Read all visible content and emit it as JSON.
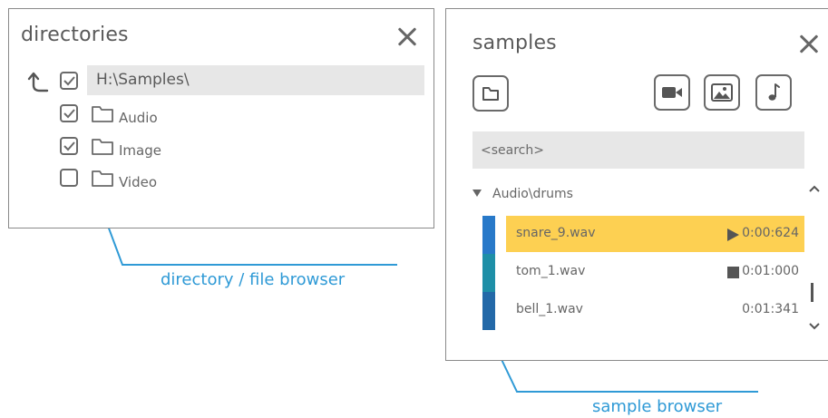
{
  "directories": {
    "title": "directories",
    "path": "H:\\Samples\\",
    "items": [
      {
        "label": "Audio",
        "checked": true
      },
      {
        "label": "Image",
        "checked": true
      },
      {
        "label": "Video",
        "checked": false
      }
    ],
    "root_checked": true
  },
  "samples": {
    "title": "samples",
    "search_placeholder": "<search>",
    "group_label": "Audio\\drums",
    "files": [
      {
        "name": "snare_9.wav",
        "duration": "0:00:624",
        "state": "playing",
        "selected": true,
        "color": "#2879c9"
      },
      {
        "name": "tom_1.wav",
        "duration": "0:01:000",
        "state": "stopped",
        "selected": false,
        "color": "#1e8fa7"
      },
      {
        "name": "bell_1.wav",
        "duration": "0:01:341",
        "state": "none",
        "selected": false,
        "color": "#2369a8"
      }
    ],
    "filter_icons": [
      "video-icon",
      "image-icon",
      "music-icon"
    ],
    "folder_icon": "folder-icon"
  },
  "callouts": {
    "directory_browser": "directory / file browser",
    "sample_browser": "sample browser"
  },
  "colors": {
    "accent": "#2f9ad6",
    "selection": "#fdd052",
    "field_bg": "#e7e7e7"
  }
}
